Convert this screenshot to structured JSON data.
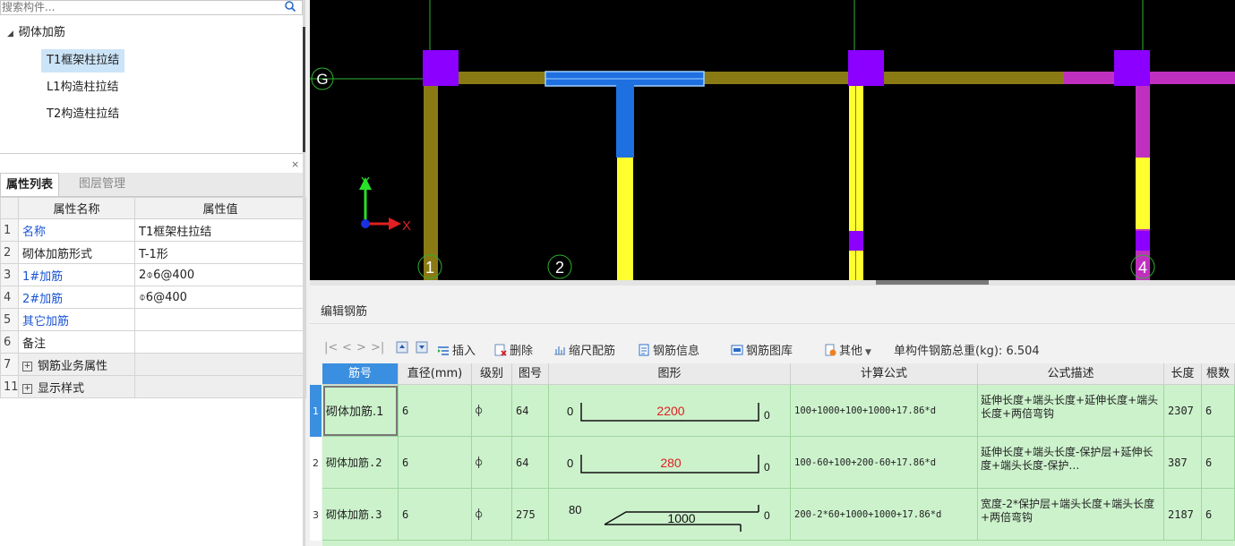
{
  "search": {
    "placeholder": "搜索构件..."
  },
  "tree": {
    "root_label": "砌体加筋",
    "items": [
      {
        "label": "T1框架柱拉结",
        "selected": true
      },
      {
        "label": "L1构造柱拉结",
        "selected": false
      },
      {
        "label": "T2构造柱拉结",
        "selected": false
      }
    ]
  },
  "tabs": {
    "properties": "属性列表",
    "layers": "图层管理",
    "close": "×"
  },
  "props": {
    "header_name": "属性名称",
    "header_value": "属性值",
    "rows": [
      {
        "num": "1",
        "name": "名称",
        "value": "T1框架柱拉结",
        "blue": true
      },
      {
        "num": "2",
        "name": "砌体加筋形式",
        "value": "T-1形",
        "blue": false
      },
      {
        "num": "3",
        "name": "1#加筋",
        "value": "2⌽6@400",
        "blue": true
      },
      {
        "num": "4",
        "name": "2#加筋",
        "value": "⌽6@400",
        "blue": true
      },
      {
        "num": "5",
        "name": "其它加筋",
        "value": "",
        "blue": true
      },
      {
        "num": "6",
        "name": "备注",
        "value": "",
        "blue": false
      },
      {
        "num": "7",
        "name": "钢筋业务属性",
        "value": "",
        "blue": false,
        "expandable": true
      },
      {
        "num": "11",
        "name": "显示样式",
        "value": "",
        "blue": false,
        "expandable": true
      }
    ]
  },
  "canvas": {
    "axis_label_g": "G",
    "axis_labels_bottom": [
      "1",
      "2",
      "4"
    ],
    "ucs_x": "X",
    "ucs_y": "Y",
    "colors": {
      "beam": "#8a7a14",
      "column": "#8b00ff",
      "selected": "#1e6fe0",
      "yellow": "#ffff30",
      "magenta": "#c030c0",
      "grid_line": "#2fb02f"
    }
  },
  "edit": {
    "title": "编辑钢筋",
    "toolbar": {
      "nav": [
        "|<",
        "<",
        ">",
        ">|"
      ],
      "insert": "插入",
      "delete": "删除",
      "scale": "缩尺配筋",
      "info": "钢筋信息",
      "library": "钢筋图库",
      "other": "其他",
      "total_label": "单构件钢筋总重(kg):",
      "total_value": "6.504"
    },
    "columns": [
      "筋号",
      "直径(mm)",
      "级别",
      "图号",
      "图形",
      "计算公式",
      "公式描述",
      "长度",
      "根数"
    ],
    "rows": [
      {
        "num": "1",
        "name": "砌体加筋.1",
        "diameter": "6",
        "grade": "⌽",
        "fig": "64",
        "shape_left": "0",
        "shape_value": "2200",
        "shape_right": "0",
        "formula": "100+1000+100+1000+17.86*d",
        "desc": "延伸长度+端头长度+延伸长度+端头长度+两倍弯钩",
        "length": "2307",
        "count": "6"
      },
      {
        "num": "2",
        "name": "砌体加筋.2",
        "diameter": "6",
        "grade": "⌽",
        "fig": "64",
        "shape_left": "0",
        "shape_value": "280",
        "shape_right": "0",
        "formula": "100-60+100+200-60+17.86*d",
        "desc": "延伸长度+端头长度-保护层+延伸长度+端头长度-保护…",
        "length": "387",
        "count": "6"
      },
      {
        "num": "3",
        "name": "砌体加筋.3",
        "diameter": "6",
        "grade": "⌽",
        "fig": "275",
        "shape_left": "80",
        "shape_value": "1000",
        "shape_right": "0",
        "formula": "200-2*60+1000+1000+17.86*d",
        "desc": "宽度-2*保护层+端头长度+端头长度+两倍弯钩",
        "length": "2187",
        "count": "6"
      }
    ]
  }
}
